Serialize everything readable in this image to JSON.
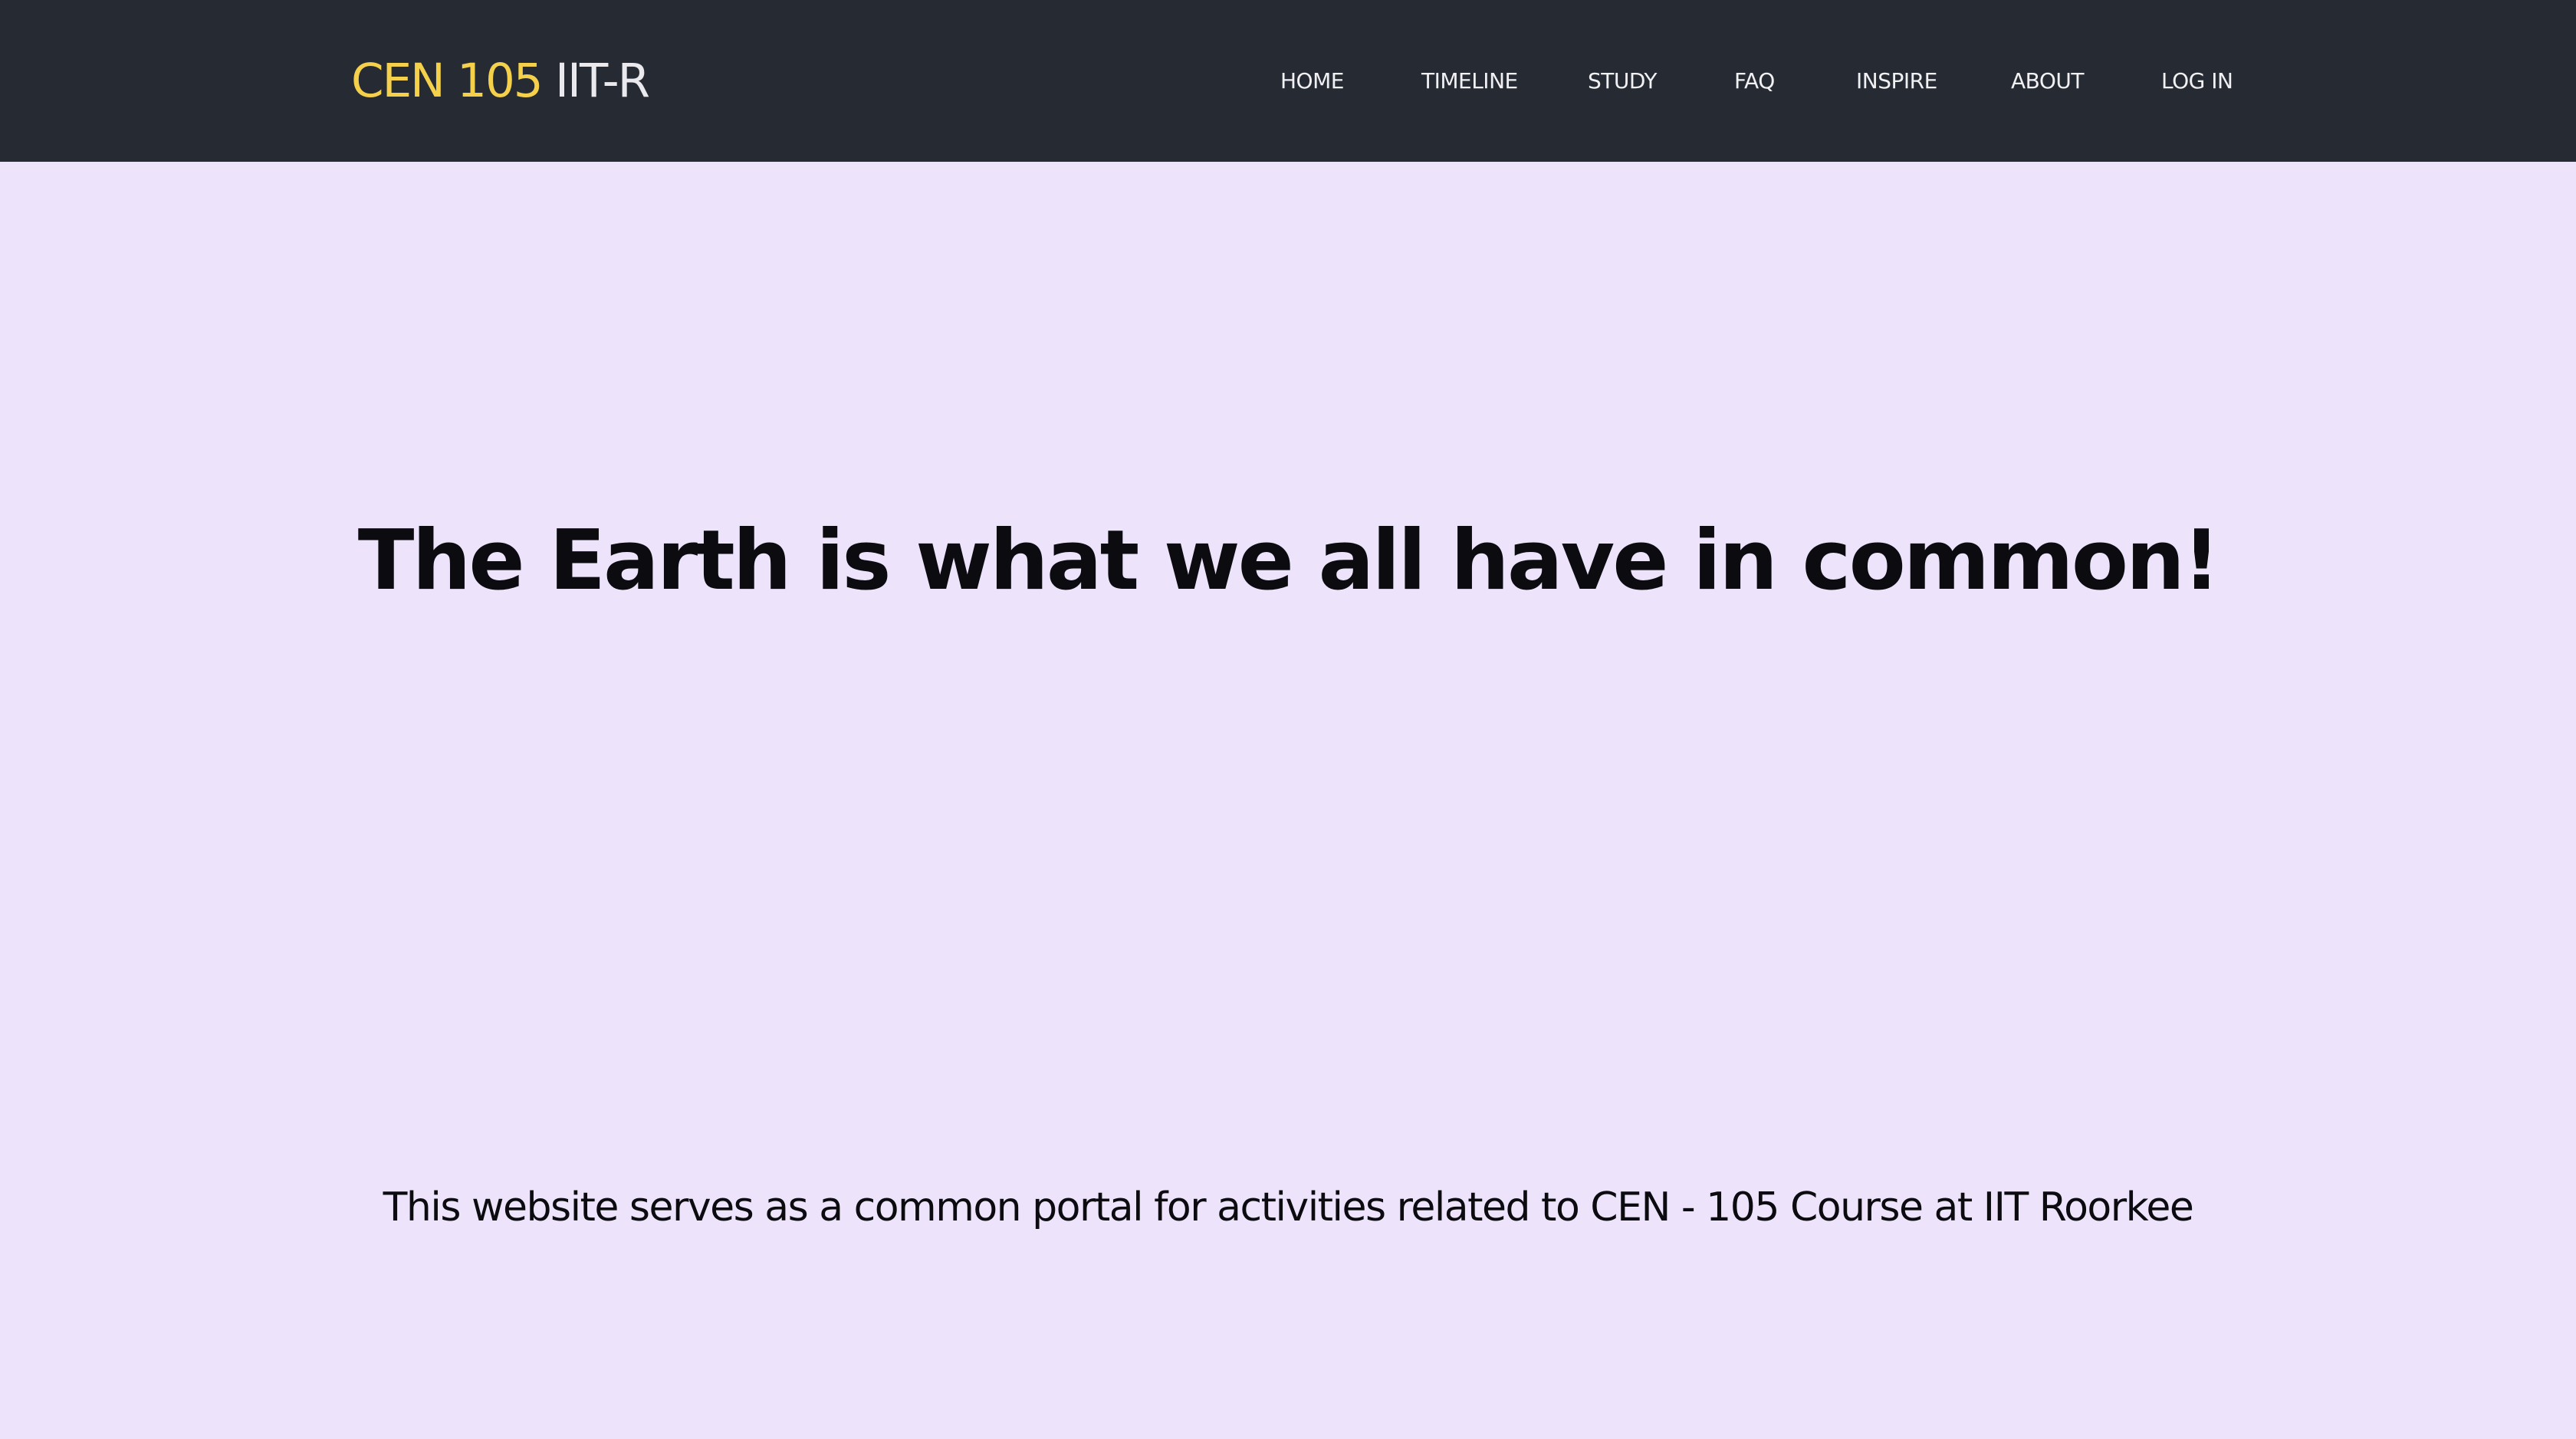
{
  "brand": {
    "accent_text": "CEN 105",
    "rest_text": " IIT-R",
    "accent_color": "#f5d04a"
  },
  "nav": {
    "items": [
      {
        "label": "HOME"
      },
      {
        "label": "TIMELINE"
      },
      {
        "label": "STUDY"
      },
      {
        "label": "FAQ"
      },
      {
        "label": "INSPIRE"
      },
      {
        "label": "ABOUT"
      },
      {
        "label": "LOG IN"
      }
    ]
  },
  "hero": {
    "title": "The Earth is what we all have in common!",
    "subtitle": "This website serves as a common portal for activities related to CEN - 105 Course at IIT Roorkee"
  },
  "colors": {
    "navbar_bg": "#252a33",
    "page_bg": "#ede4fc",
    "text_dark": "#0c0c10"
  }
}
